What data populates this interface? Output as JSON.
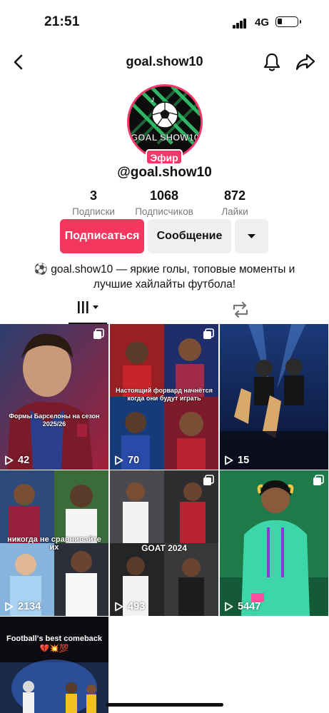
{
  "status": {
    "time": "21:51",
    "network": "4G"
  },
  "nav": {
    "title": "goal.show10"
  },
  "profile": {
    "avatar_text": "GOAL SHOW10",
    "live_badge": "Эфир",
    "handle": "@goal.show10",
    "stats": [
      {
        "value": "3",
        "label": "Подписки"
      },
      {
        "value": "1068",
        "label": "Подписчиков"
      },
      {
        "value": "872",
        "label": "Лайки"
      }
    ],
    "follow_label": "Подписаться",
    "message_label": "Сообщение",
    "bio": "⚽ goal.show10 — яркие голы, топовые моменты и лучшие хайлайты футбола!"
  },
  "colors": {
    "accent": "#f2365d",
    "live": "#f2396a"
  },
  "videos": [
    {
      "views": "42",
      "caption": "Формы Барселоны на сезон 2025/26",
      "multi": true
    },
    {
      "views": "70",
      "caption": "Настоящий форвард начнётся когда они будут играть",
      "multi": true
    },
    {
      "views": "15",
      "caption": "",
      "multi": false
    },
    {
      "views": "2134",
      "caption": "никогда не сравнивайте их",
      "multi": false
    },
    {
      "views": "493",
      "caption": "GOAT 2024",
      "multi": true
    },
    {
      "views": "5447",
      "caption": "",
      "multi": true
    },
    {
      "views": "",
      "caption": "Football's best comeback",
      "multi": false
    }
  ]
}
